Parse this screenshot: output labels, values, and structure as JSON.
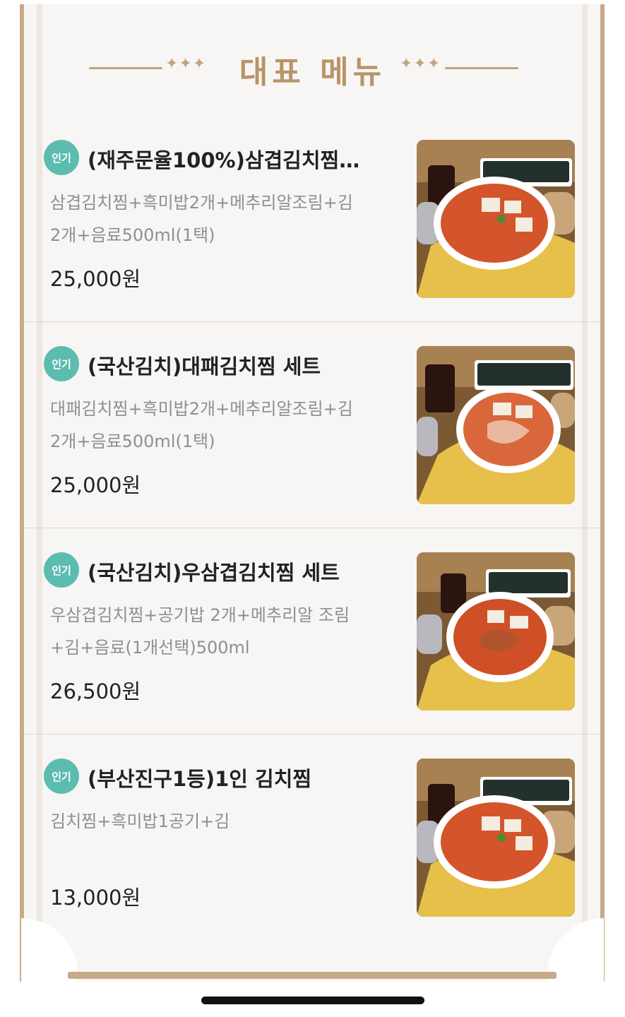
{
  "header": {
    "title": "대표 메뉴",
    "ornament_left": "✦✦✦",
    "ornament_right": "✦✦✦"
  },
  "menu": [
    {
      "badge": "인기",
      "title": "(재주문율100%)삼겹김치찜…",
      "desc_line1": "삼겹김치찜+흑미밥2개+메추리알조림+김",
      "desc_line2": "2개+음료500ml(1택)",
      "price": "25,000원"
    },
    {
      "badge": "인기",
      "title": "(국산김치)대패김치찜 세트",
      "desc_line1": "대패김치찜+흑미밥2개+메추리알조림+김",
      "desc_line2": "2개+음료500ml(1택)",
      "price": "25,000원"
    },
    {
      "badge": "인기",
      "title": "(국산김치)우삼겹김치찜 세트",
      "desc_line1": "우삼겹김치찜+공기밥 2개+메추리알 조림",
      "desc_line2": "+김+음료(1개선택)500ml",
      "price": "26,500원"
    },
    {
      "badge": "인기",
      "title": "(부산진구1등)1인 김치찜",
      "desc_line1": "김치찜+흑미밥1공기+김",
      "desc_line2": "",
      "price": "13,000원"
    }
  ],
  "colors": {
    "accent_gold": "#c4a47e",
    "badge_teal": "#5cbcb0",
    "frame": "#c8aa86"
  },
  "icons": {
    "badge": "popular-badge-icon",
    "ornament": "sparkle-icon"
  }
}
